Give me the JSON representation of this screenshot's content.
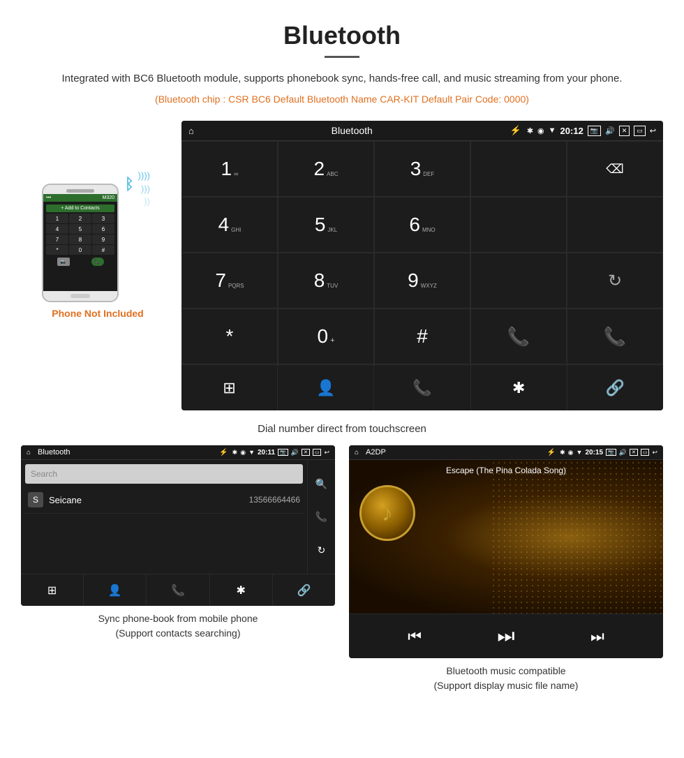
{
  "header": {
    "title": "Bluetooth",
    "description": "Integrated with BC6 Bluetooth module, supports phonebook sync, hands-free call, and music streaming from your phone.",
    "specs": "(Bluetooth chip : CSR BC6    Default Bluetooth Name CAR-KIT    Default Pair Code: 0000)"
  },
  "phone_label": "Phone Not Included",
  "car_screen": {
    "status_bar": {
      "home": "⌂",
      "title": "Bluetooth",
      "usb": "⚡",
      "bt": "✱",
      "location": "◉",
      "signal": "▼",
      "time": "20:12",
      "camera_icon": "📷",
      "volume_icon": "🔊",
      "x_icon": "✕",
      "rect_icon": "▭",
      "back_icon": "↩"
    },
    "dialer": {
      "keys": [
        {
          "label": "1",
          "sub": "∞"
        },
        {
          "label": "2",
          "sub": "ABC"
        },
        {
          "label": "3",
          "sub": "DEF"
        },
        {
          "label": "",
          "sub": ""
        },
        {
          "label": "⌫",
          "sub": ""
        },
        {
          "label": "4",
          "sub": "GHI"
        },
        {
          "label": "5",
          "sub": "JKL"
        },
        {
          "label": "6",
          "sub": "MNO"
        },
        {
          "label": "",
          "sub": ""
        },
        {
          "label": "",
          "sub": ""
        },
        {
          "label": "7",
          "sub": "PQRS"
        },
        {
          "label": "8",
          "sub": "TUV"
        },
        {
          "label": "9",
          "sub": "WXYZ"
        },
        {
          "label": "",
          "sub": ""
        },
        {
          "label": "↻",
          "sub": ""
        },
        {
          "label": "*",
          "sub": ""
        },
        {
          "label": "0",
          "sub": "+"
        },
        {
          "label": "#",
          "sub": ""
        },
        {
          "label": "📞",
          "sub": ""
        },
        {
          "label": "📞",
          "sub": "red"
        }
      ]
    },
    "toolbar": {
      "buttons": [
        "⊞",
        "👤",
        "📞",
        "✱",
        "🔗"
      ]
    }
  },
  "caption": "Dial number direct from touchscreen",
  "bottom_left": {
    "screen": {
      "status_bar": {
        "home": "⌂",
        "title": "Bluetooth",
        "usb": "⚡",
        "bt": "✱",
        "location": "◉",
        "signal": "▼",
        "time": "20:11"
      },
      "search_placeholder": "Search",
      "contact": {
        "letter": "S",
        "name": "Seicane",
        "number": "13566664466"
      },
      "toolbar_buttons": [
        "⊞",
        "👤",
        "📞",
        "✱",
        "🔗"
      ]
    },
    "caption_line1": "Sync phone-book from mobile phone",
    "caption_line2": "(Support contacts searching)"
  },
  "bottom_right": {
    "screen": {
      "status_bar": {
        "home": "⌂",
        "title": "A2DP",
        "usb": "⚡",
        "bt": "✱",
        "location": "◉",
        "signal": "▼",
        "time": "20:15"
      },
      "song_title": "Escape (The Pina Colada Song)",
      "music_note": "♪",
      "controls": [
        "⏮",
        "⏭",
        "⏭"
      ]
    },
    "caption_line1": "Bluetooth music compatible",
    "caption_line2": "(Support display music file name)"
  }
}
